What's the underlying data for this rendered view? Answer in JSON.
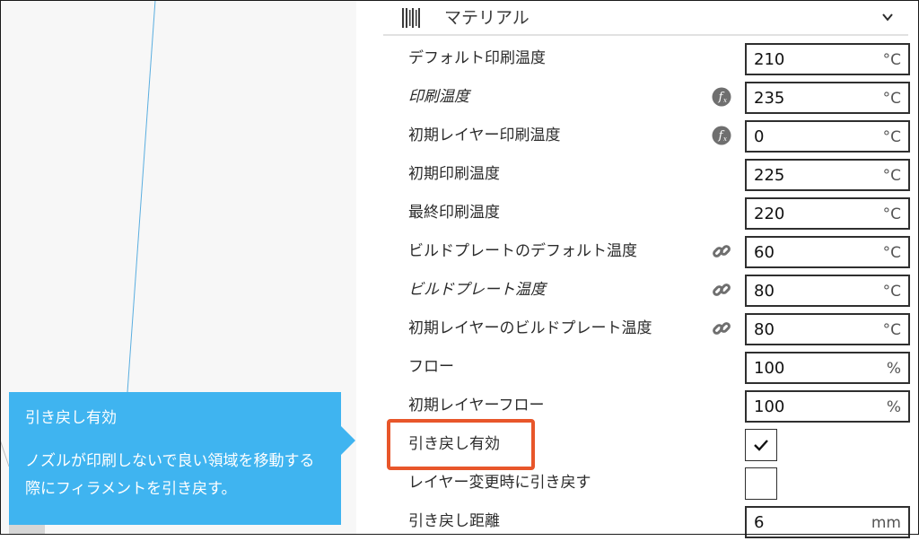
{
  "tooltip": {
    "title": "引き戻し有効",
    "description": "ノズルが印刷しないで良い領域を移動する際にフィラメントを引き戻す。"
  },
  "category": {
    "label": "マテリアル",
    "icon": "material-icon",
    "chevron": "chevron-down-icon"
  },
  "settings": [
    {
      "label": "デフォルト印刷温度",
      "value": "210",
      "unit": "°C",
      "indicator": "",
      "italic": false
    },
    {
      "label": "印刷温度",
      "value": "235",
      "unit": "°C",
      "indicator": "function-icon",
      "italic": true
    },
    {
      "label": "初期レイヤー印刷温度",
      "value": "0",
      "unit": "°C",
      "indicator": "function-icon",
      "italic": false
    },
    {
      "label": "初期印刷温度",
      "value": "225",
      "unit": "°C",
      "indicator": "",
      "italic": false
    },
    {
      "label": "最終印刷温度",
      "value": "220",
      "unit": "°C",
      "indicator": "",
      "italic": false
    },
    {
      "label": "ビルドプレートのデフォルト温度",
      "value": "60",
      "unit": "°C",
      "indicator": "link-icon",
      "italic": false
    },
    {
      "label": "ビルドプレート温度",
      "value": "80",
      "unit": "°C",
      "indicator": "link-icon",
      "italic": true
    },
    {
      "label": "初期レイヤーのビルドプレート温度",
      "value": "80",
      "unit": "°C",
      "indicator": "link-icon",
      "italic": false
    },
    {
      "label": "フロー",
      "value": "100",
      "unit": "%",
      "indicator": "",
      "italic": false
    },
    {
      "label": "初期レイヤーフロー",
      "value": "100",
      "unit": "%",
      "indicator": "",
      "italic": false
    }
  ],
  "checks": [
    {
      "label": "引き戻し有効",
      "checked": true
    },
    {
      "label": "レイヤー変更時に引き戻す",
      "checked": false
    }
  ],
  "last": {
    "label": "引き戻し距離",
    "value": "6",
    "unit": "mm"
  }
}
